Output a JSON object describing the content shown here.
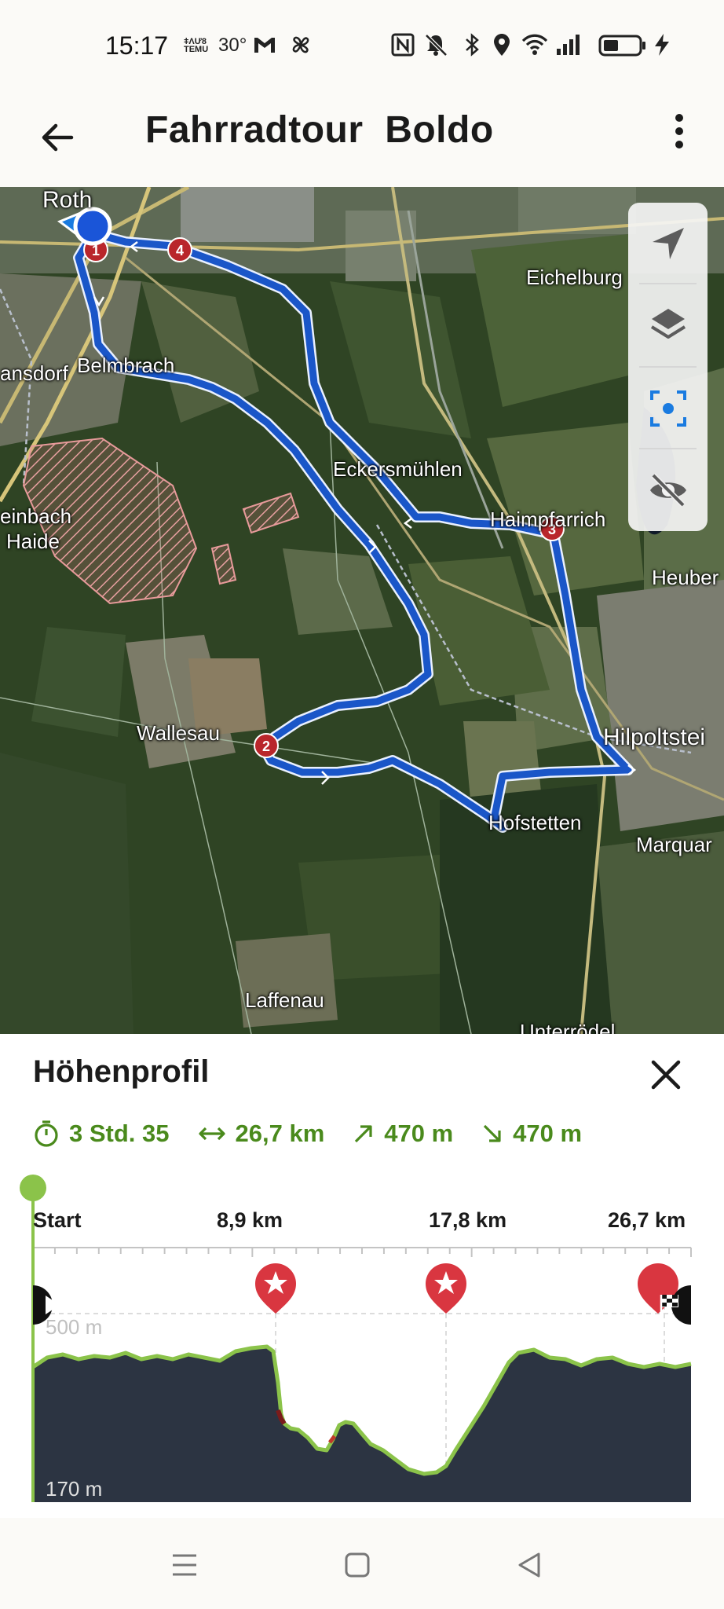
{
  "status_bar": {
    "time": "15:17",
    "temu_top": "ǂΛƯ8",
    "temu_bottom": "TEMU",
    "temperature": "30°",
    "icons": [
      "gmail-icon",
      "pinwheel-icon",
      "nfc-icon",
      "mute-icon",
      "bluetooth-icon",
      "location-icon",
      "wifi-icon",
      "signal-icon",
      "battery-icon",
      "charging-icon"
    ]
  },
  "app_bar": {
    "title": "Fahrradtour  Boldo",
    "back_icon": "arrow-left-icon",
    "menu_icon": "more-vert-icon"
  },
  "map": {
    "places": {
      "roth": "Roth",
      "eichelburg": "Eichelburg",
      "belmbrach": "Belmbrach",
      "ansdorf": "ansdorf",
      "einbach": "einbach",
      "haide": "Haide",
      "eckersmuehlen": "Eckersmühlen",
      "haimpfarrich": "Haimpfarrich",
      "heuber": "Heuber",
      "wallesau": "Wallesau",
      "hilpoltstein": "Hilpoltstei",
      "hofstetten": "Hofstetten",
      "marquar": "Marquar",
      "laffenau": "Laffenau",
      "unterroedel": "Unterrödel"
    },
    "waypoints": [
      "1",
      "2",
      "3",
      "4"
    ],
    "controls": [
      "navigation-arrow-icon",
      "layers-icon",
      "focus-target-icon",
      "visibility-off-icon"
    ],
    "route_color": "#1a56c8",
    "accent_color": "#1a7be0"
  },
  "panel": {
    "title": "Höhenprofil",
    "close_icon": "close-icon",
    "stats": {
      "duration": "3 Std. 35",
      "distance": "26,7 km",
      "ascent": "470 m",
      "descent": "470 m"
    },
    "distance_labels": [
      "Start",
      "8,9 km",
      "17,8 km",
      "26,7 km"
    ],
    "elevation_labels": {
      "max": "500 m",
      "min": "170 m"
    },
    "accent_color": "#4a8a1c",
    "profile_line_color": "#8bc34a",
    "profile_fill_color": "#2c3442"
  },
  "nav_bar": {
    "icons": [
      "recents-icon",
      "home-icon",
      "back-icon"
    ]
  }
}
